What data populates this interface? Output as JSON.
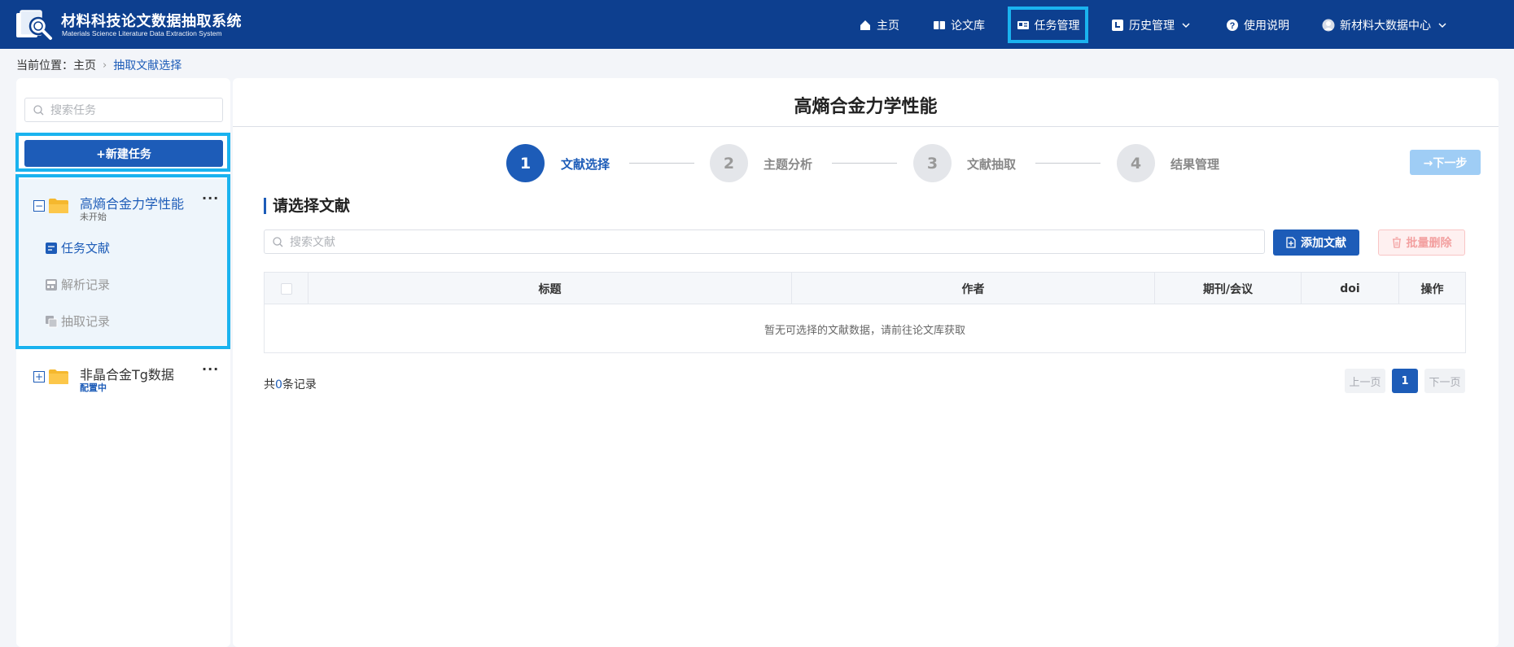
{
  "header": {
    "title_cn": "材料科技论文数据抽取系统",
    "title_en": "Materials Science Literature Data Extraction System",
    "nav": [
      {
        "label": "主页",
        "icon": "home-icon"
      },
      {
        "label": "论文库",
        "icon": "book-icon"
      },
      {
        "label": "任务管理",
        "icon": "task-card-icon"
      },
      {
        "label": "历史管理",
        "icon": "history-icon"
      },
      {
        "label": "使用说明",
        "icon": "help-icon"
      },
      {
        "label": "新材料大数据中心",
        "icon": "user-avatar-icon"
      }
    ]
  },
  "breadcrumb": {
    "prefix": "当前位置：",
    "home": "主页",
    "current": "抽取文献选择"
  },
  "sidebar": {
    "search_placeholder": "搜索任务",
    "new_task_label": "+新建任务",
    "tasks": [
      {
        "name": "高熵合金力学性能",
        "status": "未开始",
        "expanded": true,
        "children": [
          {
            "label": "任务文献",
            "active": true
          },
          {
            "label": "解析记录",
            "active": false
          },
          {
            "label": "抽取记录",
            "active": false
          }
        ]
      },
      {
        "name": "非晶合金Tg数据",
        "status": "配置中",
        "expanded": false
      }
    ]
  },
  "main": {
    "title": "高熵合金力学性能",
    "steps": [
      {
        "num": "1",
        "label": "文献选择",
        "active": true
      },
      {
        "num": "2",
        "label": "主题分析",
        "active": false
      },
      {
        "num": "3",
        "label": "文献抽取",
        "active": false
      },
      {
        "num": "4",
        "label": "结果管理",
        "active": false
      }
    ],
    "next_label": "→下一步",
    "section_title": "请选择文献",
    "search_placeholder": "搜索文献",
    "add_label": "添加文献",
    "delete_label": "批量删除",
    "table": {
      "columns": [
        "标题",
        "作者",
        "期刊/会议",
        "doi",
        "操作"
      ],
      "empty_text": "暂无可选择的文献数据，请前往论文库获取"
    },
    "footer": {
      "total_prefix": "共",
      "total_count": "0",
      "total_suffix": "条记录",
      "prev": "上一页",
      "page": "1",
      "next": "下一页"
    }
  },
  "colors": {
    "header_bg": "#0d3f8f",
    "primary": "#1d5cb8",
    "highlight": "#1ab3ef",
    "folder": "#f5b82e"
  }
}
